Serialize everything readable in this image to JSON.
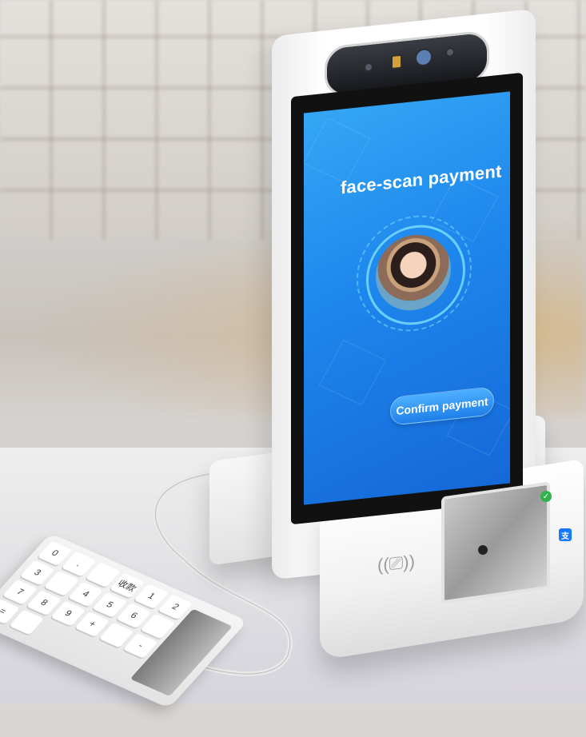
{
  "screen": {
    "title": "face-scan payment",
    "confirm_label": "Confirm payment"
  },
  "keypad": {
    "keys": [
      "0",
      ".",
      "",
      "收款",
      "1",
      "2",
      "3",
      "",
      "4",
      "5",
      "6",
      "",
      "7",
      "8",
      "9",
      "+",
      "",
      "-",
      "=",
      "",
      "",
      "",
      "",
      ""
    ]
  },
  "icons": {
    "nfc": "contactless-icon",
    "check": "check-badge-icon",
    "alipay": "alipay-icon"
  },
  "colors": {
    "screen_top": "#35a6f5",
    "screen_bottom": "#1568d8",
    "button": "#1f7ee8"
  }
}
